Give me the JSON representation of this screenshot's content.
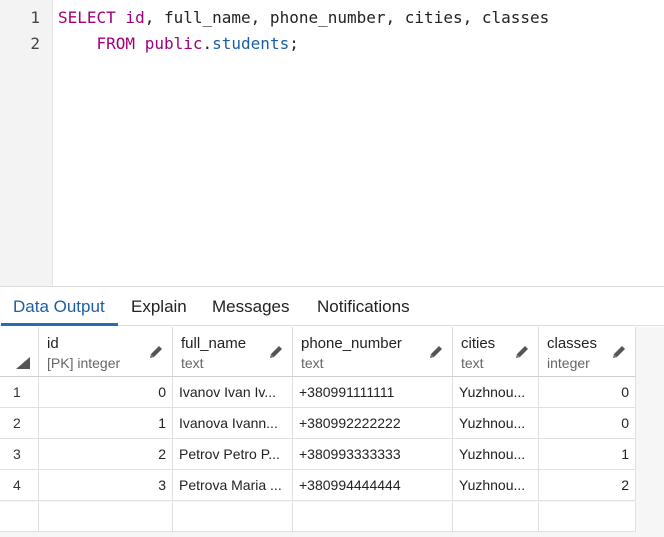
{
  "editor": {
    "line_numbers": [
      "1",
      "2"
    ],
    "line1": {
      "kw_select": "SELECT",
      "col_id": " id",
      "rest": ", full_name, phone_number, cities, classes"
    },
    "line2": {
      "indent": "    ",
      "kw_from": "FROM",
      "space": " ",
      "schema": "public",
      "dot": ".",
      "table": "students",
      "semicolon": ";"
    }
  },
  "tabs": [
    {
      "label": "Data Output",
      "active": true
    },
    {
      "label": "Explain",
      "active": false
    },
    {
      "label": "Messages",
      "active": false
    },
    {
      "label": "Notifications",
      "active": false
    }
  ],
  "grid": {
    "columns": [
      {
        "name": "id",
        "type": "[PK] integer"
      },
      {
        "name": "full_name",
        "type": "text"
      },
      {
        "name": "phone_number",
        "type": "text"
      },
      {
        "name": "cities",
        "type": "text"
      },
      {
        "name": "classes",
        "type": "integer"
      }
    ],
    "rows": [
      {
        "num": "1",
        "id": "0",
        "full_name": "Ivanov Ivan Iv...",
        "phone_number": "+380991111111",
        "cities": "Yuzhnou...",
        "classes": "0"
      },
      {
        "num": "2",
        "id": "1",
        "full_name": "Ivanova Ivann...",
        "phone_number": "+380992222222",
        "cities": "Yuzhnou...",
        "classes": "0"
      },
      {
        "num": "3",
        "id": "2",
        "full_name": "Petrov Petro P...",
        "phone_number": "+380993333333",
        "cities": "Yuzhnou...",
        "classes": "1"
      },
      {
        "num": "4",
        "id": "3",
        "full_name": "Petrova Maria ...",
        "phone_number": "+380994444444",
        "cities": "Yuzhnou...",
        "classes": "2"
      }
    ]
  },
  "colors": {
    "keyword": "#a0007a",
    "identifier": "#1a5ea8",
    "active_tab": "#1d5fa3"
  }
}
